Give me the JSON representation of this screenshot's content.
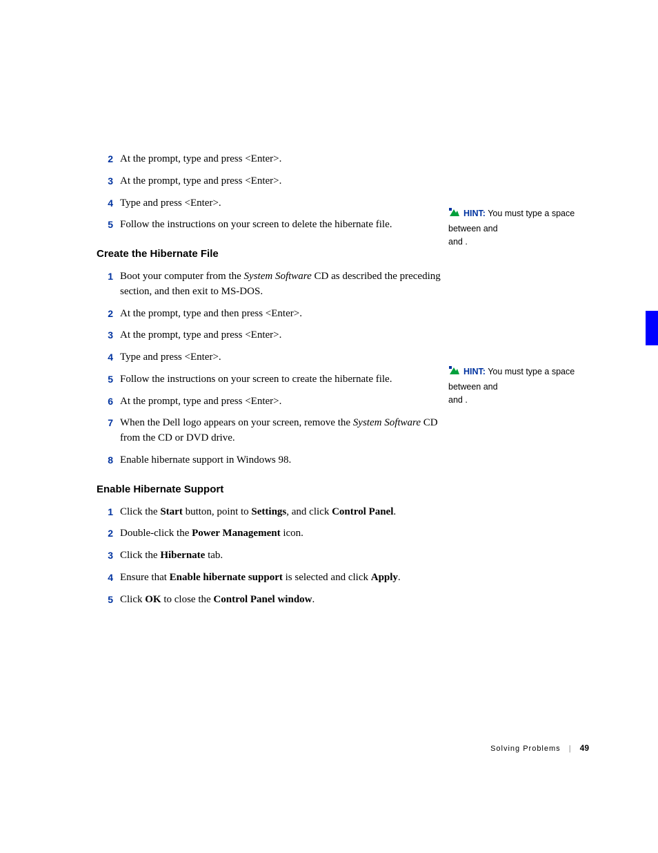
{
  "listA": {
    "items": [
      {
        "n": "2",
        "text": "At the          prompt, type        and press <Enter>."
      },
      {
        "n": "3",
        "text": "At the      prompt, type                     and press <Enter>."
      },
      {
        "n": "4",
        "text": "Type                               and press <Enter>."
      },
      {
        "n": "5",
        "text": "Follow the instructions on your screen to delete the hibernate file."
      }
    ]
  },
  "section1": {
    "title": "Create the Hibernate File"
  },
  "listB": {
    "items": [
      {
        "n": "1",
        "pre": "Boot your computer from the ",
        "italic": "System Software",
        "post": " CD as described the preceding section, and then exit to MS-DOS."
      },
      {
        "n": "2",
        "text": "At the          prompt, type        and then press <Enter>."
      },
      {
        "n": "3",
        "text": "At the      prompt, type                             and press <Enter>."
      },
      {
        "n": "4",
        "text": "Type                               and press <Enter>."
      },
      {
        "n": "5",
        "text": "Follow the instructions on your screen to create the hibernate file."
      },
      {
        "n": "6",
        "text": "At the                             prompt, type                       and press <Enter>."
      },
      {
        "n": "7",
        "pre": "When the Dell logo appears on your screen, remove the ",
        "italic": "System Software",
        "post": " CD from the CD or DVD drive."
      },
      {
        "n": "8",
        "text": "Enable hibernate support in Windows 98."
      }
    ]
  },
  "section2": {
    "title": "Enable Hibernate Support"
  },
  "listC": {
    "items": [
      {
        "n": "1",
        "parts": [
          {
            "t": "Click the "
          },
          {
            "t": "Start",
            "b": true
          },
          {
            "t": " button, point to "
          },
          {
            "t": "Settings",
            "b": true
          },
          {
            "t": ", and click "
          },
          {
            "t": "Control Panel",
            "b": true
          },
          {
            "t": "."
          }
        ]
      },
      {
        "n": "2",
        "parts": [
          {
            "t": "Double-click the "
          },
          {
            "t": "Power Management",
            "b": true
          },
          {
            "t": " icon."
          }
        ]
      },
      {
        "n": "3",
        "parts": [
          {
            "t": "Click the "
          },
          {
            "t": "Hibernate",
            "b": true
          },
          {
            "t": " tab."
          }
        ]
      },
      {
        "n": "4",
        "parts": [
          {
            "t": "Ensure that "
          },
          {
            "t": "Enable hibernate support",
            "b": true
          },
          {
            "t": " is selected and click "
          },
          {
            "t": "Apply",
            "b": true
          },
          {
            "t": "."
          }
        ]
      },
      {
        "n": "5",
        "parts": [
          {
            "t": "Click "
          },
          {
            "t": "OK",
            "b": true
          },
          {
            "t": " to close the "
          },
          {
            "t": "Control Panel window",
            "b": true
          },
          {
            "t": "."
          }
        ]
      }
    ]
  },
  "hint1": {
    "label": "HINT:",
    "line1": " You must type a space between ",
    "line1b": "          and",
    "line2": "            and           ."
  },
  "hint2": {
    "label": "HINT:",
    "line1": " You must type a space between ",
    "line1b": "          and",
    "line2": "            and           ."
  },
  "footer": {
    "section": "Solving Problems",
    "page": "49"
  }
}
